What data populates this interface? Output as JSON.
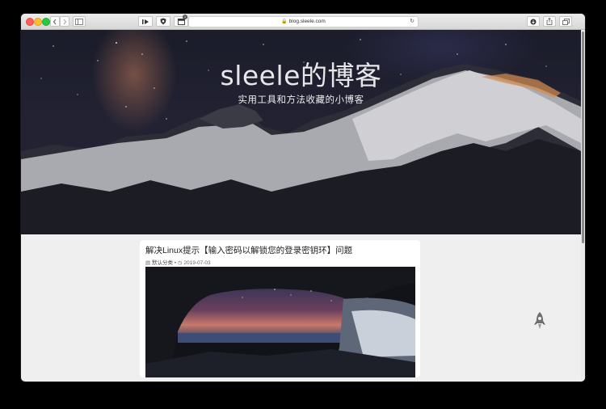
{
  "browser": {
    "url": "blog.sleele.com",
    "tab_badge": "1",
    "back_icon": "chevron-left-icon",
    "forward_icon": "chevron-right-icon",
    "sidebar_icon": "sidebar-icon",
    "reload_icon": "reload-icon",
    "download_icon": "download-icon",
    "share_icon": "share-icon",
    "tabs_icon": "tabs-icon"
  },
  "hero": {
    "title": "sleele的博客",
    "subtitle": "实用工具和方法收藏的小博客"
  },
  "post": {
    "title": "解决Linux提示【输入密码以解锁您的登录密钥环】问题",
    "category": "默认分类",
    "date": "2019-07-03"
  },
  "colors": {
    "page_background": "#efefef",
    "card_background": "#ffffff",
    "title_text": "#222222"
  }
}
